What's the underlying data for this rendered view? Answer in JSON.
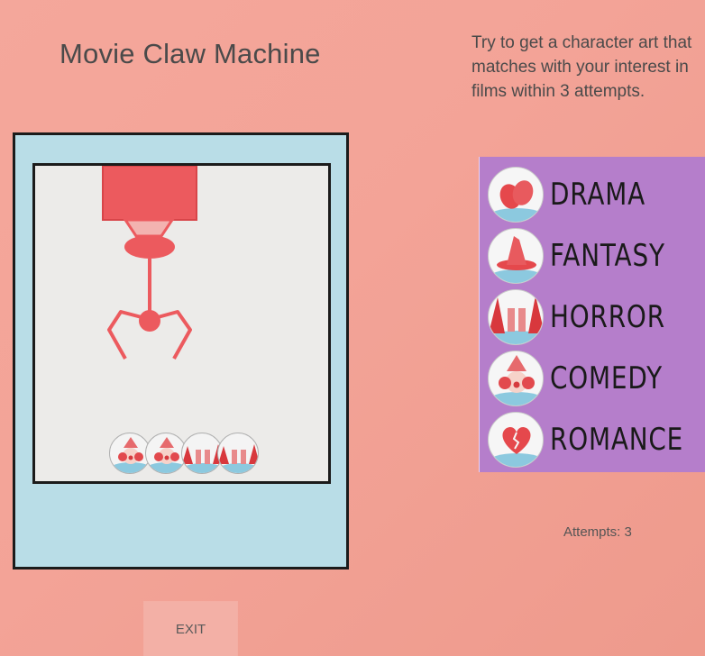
{
  "title": "Movie Claw Machine",
  "instructions": {
    "line1": "Try to get a character art that",
    "line2": "matches with your interest in",
    "line3": "films within 3 attempts."
  },
  "machine": {
    "prizes": [
      {
        "icon": "clown-icon"
      },
      {
        "icon": "clown-icon"
      },
      {
        "icon": "horror-figure-icon"
      },
      {
        "icon": "horror-figure-icon"
      }
    ]
  },
  "genres": [
    {
      "label": "DRAMA",
      "icon": "drama-masks-icon"
    },
    {
      "label": "FANTASY",
      "icon": "wizard-hat-icon"
    },
    {
      "label": "HORROR",
      "icon": "horror-figure-icon"
    },
    {
      "label": "COMEDY",
      "icon": "clown-icon"
    },
    {
      "label": "ROMANCE",
      "icon": "broken-heart-icon"
    }
  ],
  "attempts": {
    "text": "Attempts: 3",
    "value": 3
  },
  "exit_label": "EXIT",
  "colors": {
    "background": "#f3a397",
    "machine": "#b9dde7",
    "claw": "#ec5a5e",
    "panel": "#b57ecb"
  }
}
